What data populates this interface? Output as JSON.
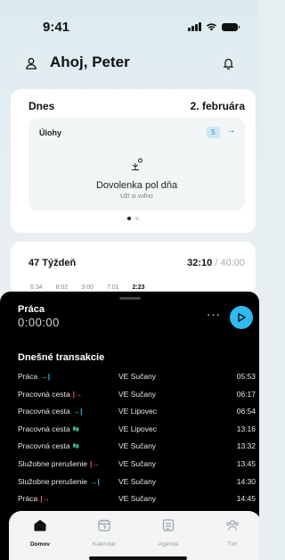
{
  "status_bar": {
    "time": "9:41"
  },
  "header": {
    "greeting": "Ahoj, Peter"
  },
  "today": {
    "title": "Dnes",
    "date": "2. februára",
    "tasks_label": "Úlohy",
    "tasks_count": "5",
    "vacation_title": "Dovolenka pol dňa",
    "vacation_subtitle": "Užī si voľno"
  },
  "week": {
    "label": "47 Týždeň",
    "hours_done": "32:10",
    "hours_total": " / 40:00",
    "days": [
      "6:34",
      "8:02",
      "3:00",
      "7:01",
      "2:23"
    ]
  },
  "work": {
    "title": "Práca",
    "timer": "0:00:00",
    "more_label": "···"
  },
  "transactions": {
    "title": "Dnešné transakcie",
    "rows": [
      {
        "type": "Práca",
        "icon": "→|",
        "kind": "in",
        "location": "VE Sučany",
        "time": "05:53"
      },
      {
        "type": "Pracovná cesta",
        "icon": "|→",
        "kind": "out",
        "location": "VE Sučany",
        "time": "06:17"
      },
      {
        "type": "Pracovná cesta",
        "icon": "→|",
        "kind": "in",
        "location": "VE Lipovec",
        "time": "06:54"
      },
      {
        "type": "Pracovná cesta",
        "icon": "⇆",
        "kind": "sw",
        "location": "VE Lipovec",
        "time": "13:16"
      },
      {
        "type": "Pracovná cesta",
        "icon": "⇆",
        "kind": "sw",
        "location": "VE Sučany",
        "time": "13:32"
      },
      {
        "type": "Služobne prerušenie",
        "icon": "|→",
        "kind": "out",
        "location": "VE Sučany",
        "time": "13:45"
      },
      {
        "type": "Služobne prerušenie",
        "icon": "→|",
        "kind": "in",
        "location": "VE Sučany",
        "time": "14:30"
      },
      {
        "type": "Práca",
        "icon": "|→",
        "kind": "out",
        "location": "VE Sučany",
        "time": "14:45"
      }
    ]
  },
  "tabs": [
    {
      "label": "Domov",
      "icon": "home-icon",
      "active": true
    },
    {
      "label": "Kalendár",
      "icon": "calendar-icon",
      "active": false
    },
    {
      "label": "Agenda",
      "icon": "agenda-icon",
      "active": false
    },
    {
      "label": "Tím",
      "icon": "team-icon",
      "active": false
    }
  ],
  "colors": {
    "accent": "#2fbaf2",
    "in": "#35b8f0",
    "out": "#f0574e",
    "switch": "#3fcf8e"
  }
}
